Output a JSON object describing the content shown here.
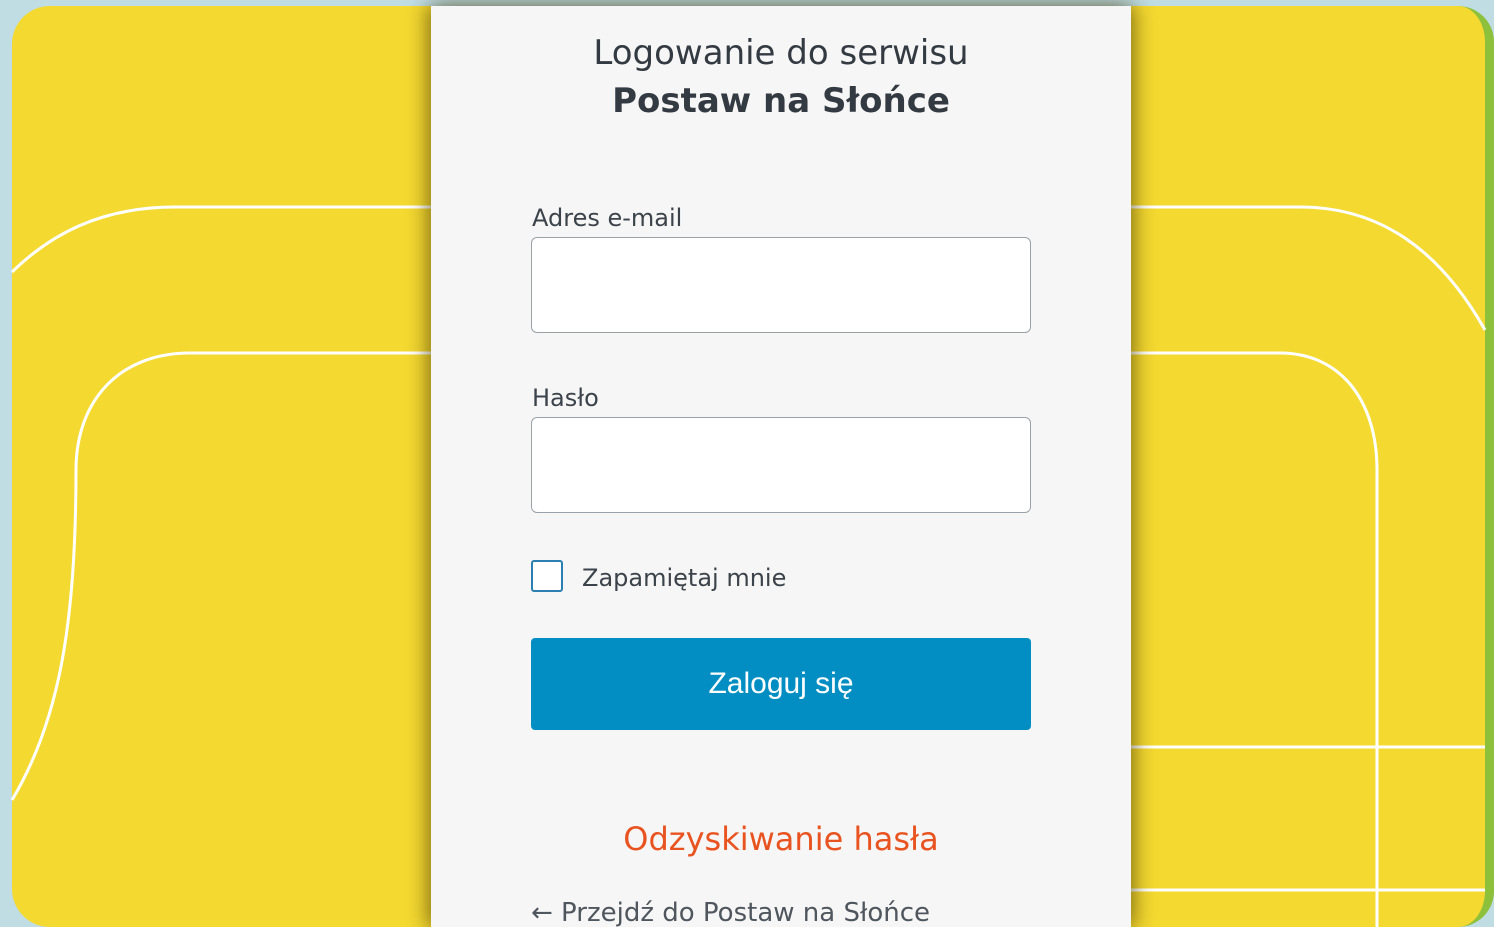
{
  "login": {
    "title_line1": "Logowanie do serwisu",
    "title_line2": "Postaw na Słońce",
    "email_label": "Adres e-mail",
    "email_value": "",
    "password_label": "Hasło",
    "password_value": "",
    "show_password_icon": "eye-icon",
    "remember_label": "Zapamiętaj mnie",
    "remember_checked": false,
    "submit_label": "Zaloguj się",
    "recover_link": "Odzyskiwanie hasła",
    "back_link": "← Przejdź do Postaw na Słońce"
  },
  "colors": {
    "page_background": "#bfdde3",
    "panel_yellow": "#f4d931",
    "panel_edge_green": "#8dc03b",
    "card_background": "#f6f6f6",
    "button_blue": "#028ec3",
    "link_orange": "#e8531f",
    "icon_blue": "#2271b1"
  }
}
